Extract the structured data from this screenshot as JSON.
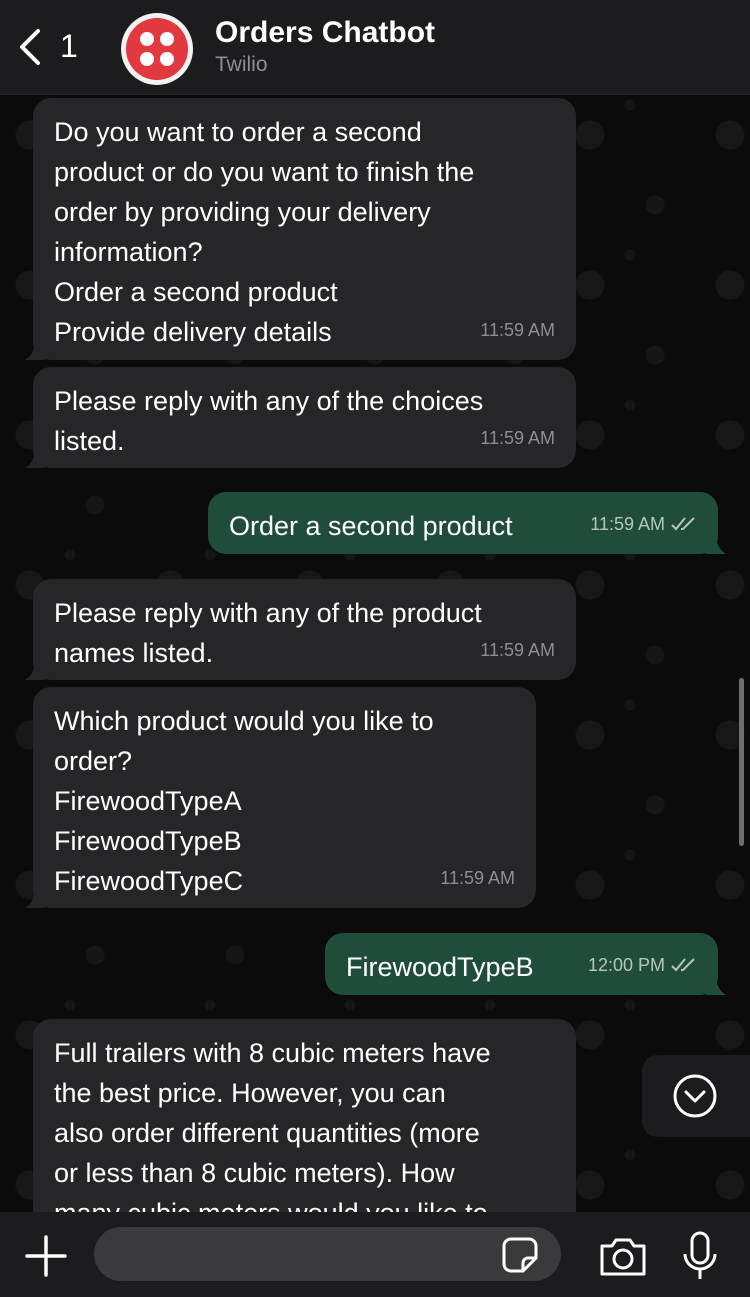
{
  "header": {
    "back_count": "1",
    "title": "Orders Chatbot",
    "subtitle": "Twilio"
  },
  "messages": [
    {
      "direction": "in",
      "text": "Do you want to order a second\nproduct or do you want to finish the\norder by providing your delivery\ninformation?\nOrder a second product\nProvide delivery details",
      "time": "11:59 AM"
    },
    {
      "direction": "in",
      "text": "Please reply with any of the choices\nlisted.",
      "time": "11:59 AM"
    },
    {
      "direction": "out",
      "text": "Order a second product",
      "time": "11:59 AM",
      "status": "read"
    },
    {
      "direction": "in",
      "text": "Please reply with any of the product\nnames listed.",
      "time": "11:59 AM"
    },
    {
      "direction": "in",
      "text": "Which product would you like to\norder?\nFirewoodTypeA\nFirewoodTypeB\nFirewoodTypeC",
      "time": "11:59 AM"
    },
    {
      "direction": "out",
      "text": "FirewoodTypeB",
      "time": "12:00 PM",
      "status": "read"
    },
    {
      "direction": "in",
      "text": "Full trailers with 8 cubic meters have\nthe best price. However, you can\nalso order different quantities (more\nor less than 8 cubic meters). How\nmany cubic meters would you like to",
      "time": ""
    }
  ],
  "composer": {
    "value": "",
    "placeholder": ""
  },
  "icons": {
    "back": "chevron-left-icon",
    "avatar": "twilio-logo",
    "plus": "plus-icon",
    "sticker": "sticker-icon",
    "camera": "camera-icon",
    "mic": "microphone-icon",
    "scroll": "chevron-down-circle-icon",
    "read": "double-check-icon"
  },
  "colors": {
    "incoming_bubble": "#262628",
    "outgoing_bubble": "#1f4d3a",
    "header_bg": "#1c1c1e",
    "twilio_red": "#e2383f"
  }
}
